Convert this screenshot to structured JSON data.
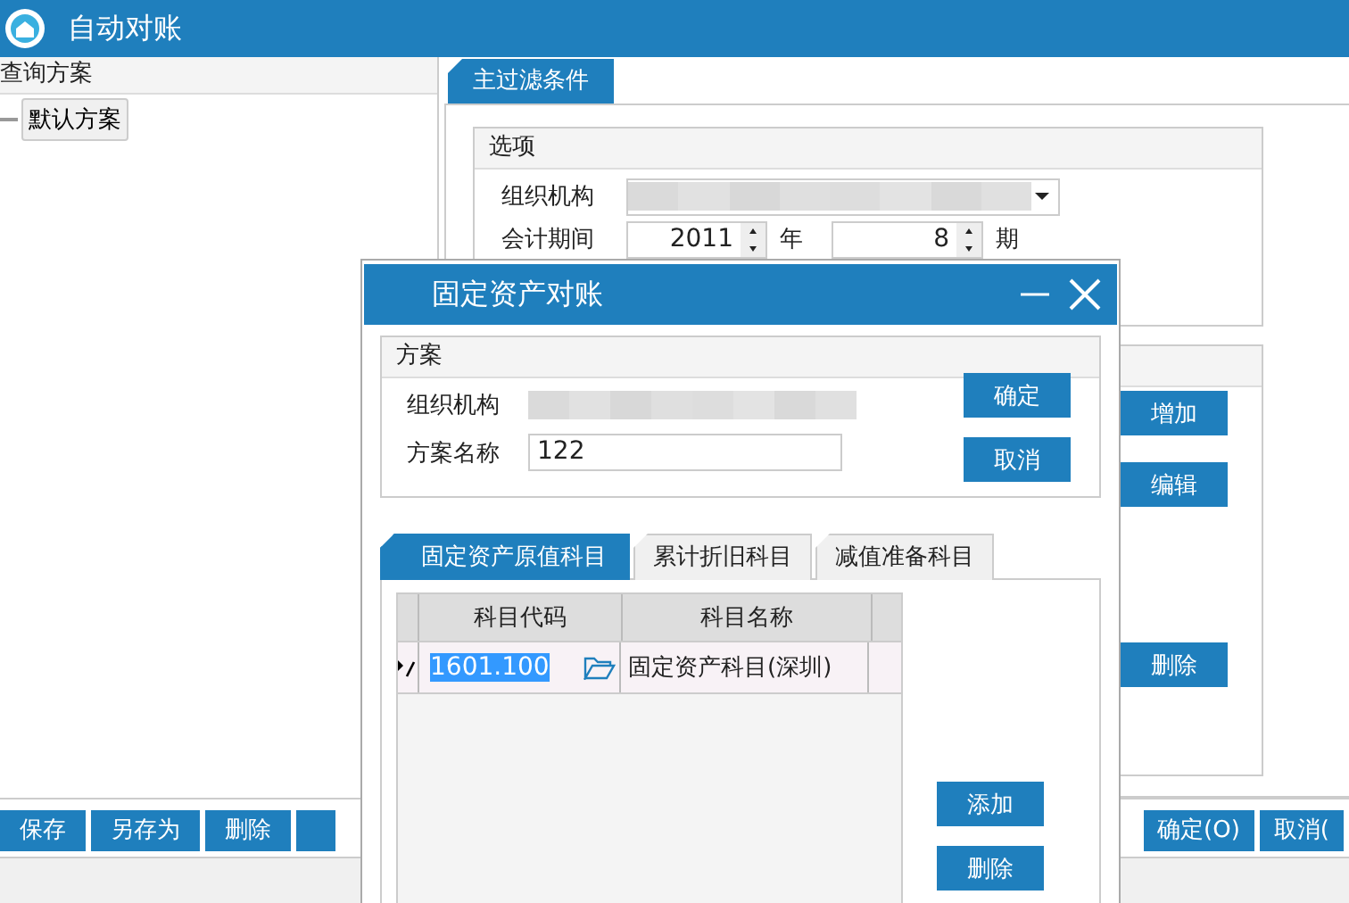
{
  "window": {
    "title": "自动对账"
  },
  "query_panel": {
    "title": "查询方案",
    "items": [
      {
        "label": "默认方案"
      }
    ]
  },
  "main_tabs": [
    {
      "label": "主过滤条件",
      "selected": true
    }
  ],
  "options": {
    "title": "选项",
    "org_label": "组织机构",
    "period_label": "会计期间",
    "year": "2011",
    "year_unit": "年",
    "period": "8",
    "period_unit": "期"
  },
  "side_buttons": [
    {
      "label": "增加"
    },
    {
      "label": "编辑"
    },
    {
      "label": "删除"
    }
  ],
  "toolbar_left": [
    {
      "kind": "button",
      "label": "保存"
    },
    {
      "kind": "button",
      "label": "另存为"
    },
    {
      "kind": "button",
      "label": "删除"
    },
    {
      "kind": "cut"
    }
  ],
  "toolbar_right": [
    {
      "label": "确定(O)"
    },
    {
      "label": "取消("
    }
  ],
  "dialog": {
    "title": "固定资产对账",
    "scheme": {
      "title": "方案",
      "org_label": "组织机构",
      "name_label": "方案名称",
      "name_value": "122"
    },
    "buttons": [
      {
        "label": "确定"
      },
      {
        "label": "取消"
      }
    ],
    "tabs": [
      {
        "label": "固定资产原值科目",
        "selected": true
      },
      {
        "label": "累计折旧科目",
        "selected": false
      },
      {
        "label": "减值准备科目",
        "selected": false
      }
    ],
    "grid": {
      "columns": [
        "科目代码",
        "科目名称"
      ],
      "rows": [
        {
          "code": "1601.100",
          "name": "固定资产科目(深圳)",
          "editing": true
        }
      ]
    },
    "grid_buttons": [
      {
        "label": "添加"
      },
      {
        "label": "删除"
      }
    ]
  }
}
